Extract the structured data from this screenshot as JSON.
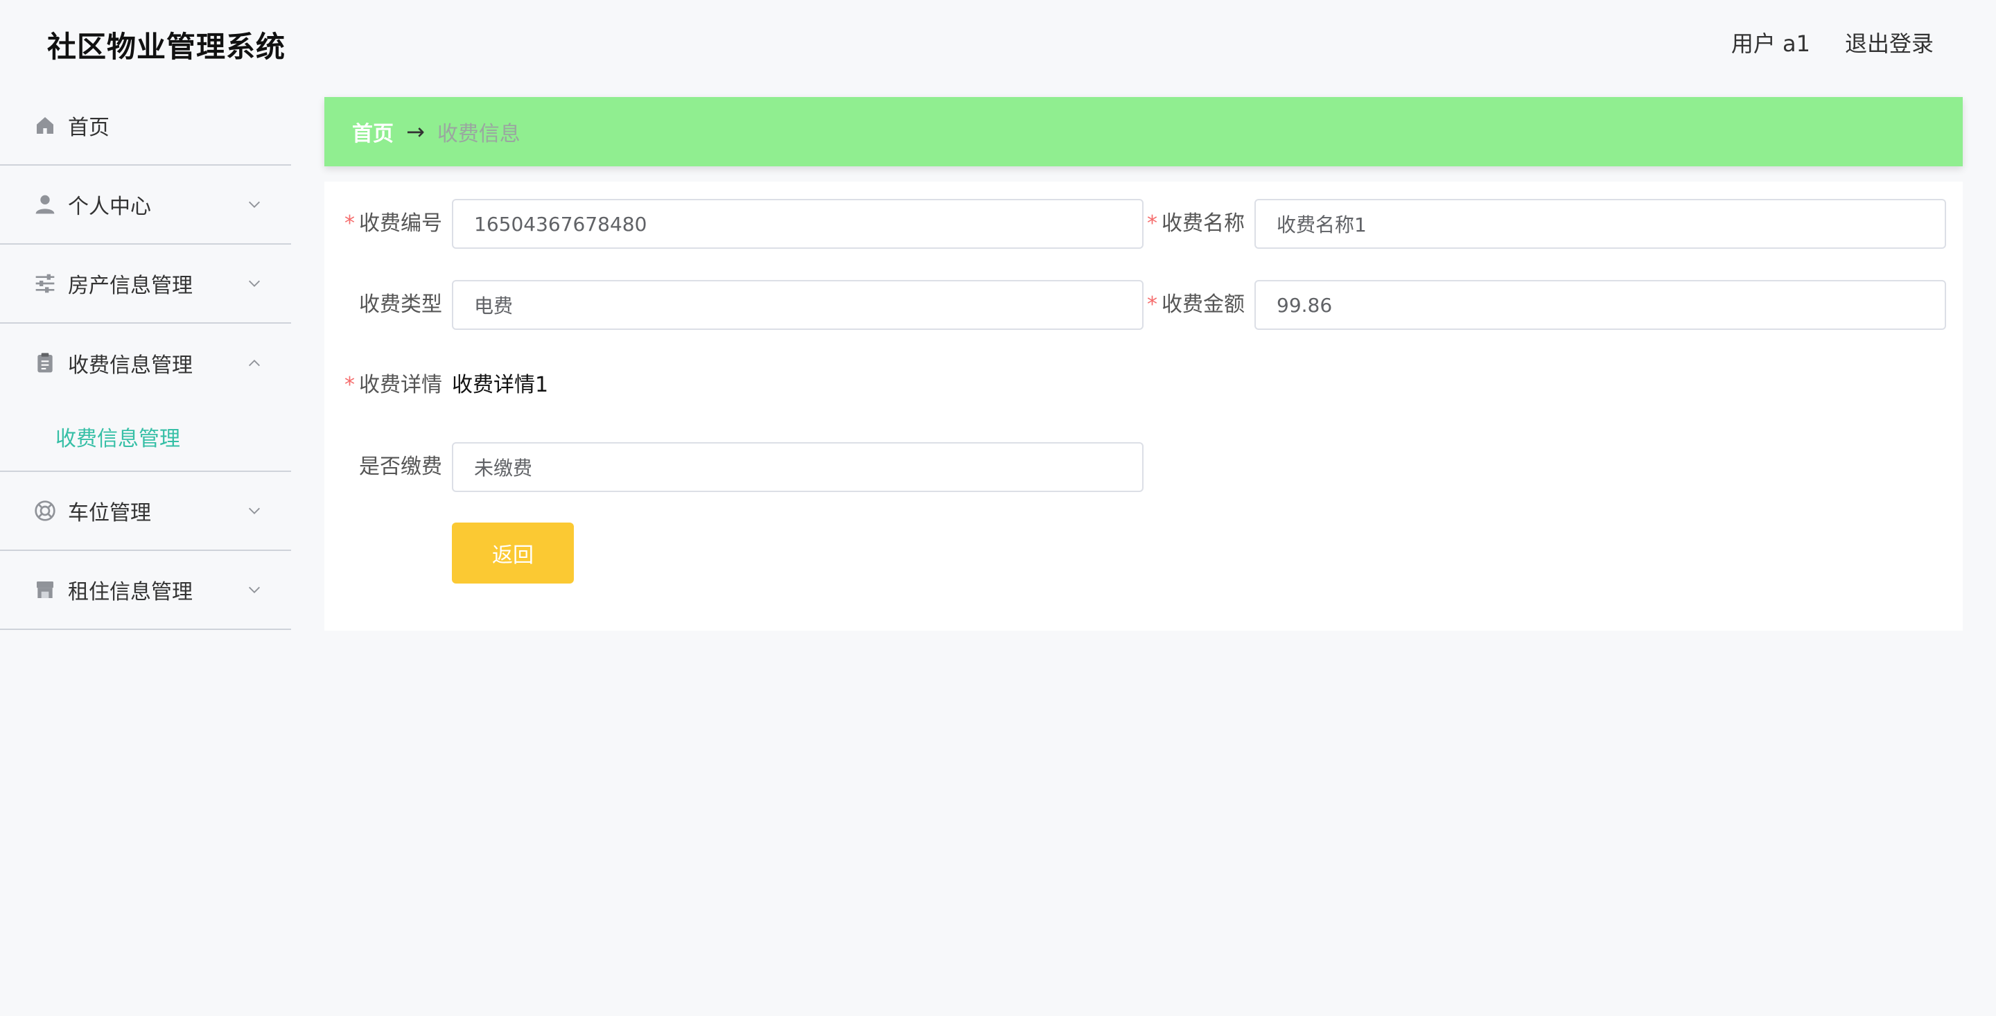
{
  "header": {
    "app_title": "社区物业管理系统",
    "user_label": "用户 a1",
    "logout_label": "退出登录"
  },
  "sidebar": {
    "items": [
      {
        "label": "首页",
        "icon": "home-icon"
      },
      {
        "label": "个人中心",
        "icon": "user-icon"
      },
      {
        "label": "房产信息管理",
        "icon": "sliders-icon"
      },
      {
        "label": "收费信息管理",
        "icon": "clipboard-icon",
        "expanded": true,
        "children": [
          {
            "label": "收费信息管理"
          }
        ]
      },
      {
        "label": "车位管理",
        "icon": "lifebuoy-icon"
      },
      {
        "label": "租住信息管理",
        "icon": "storefront-icon"
      }
    ]
  },
  "breadcrumb": {
    "home": "首页",
    "separator": "→",
    "current": "收费信息"
  },
  "form": {
    "fee_no": {
      "label": "收费编号",
      "value": "16504367678480",
      "required": true
    },
    "fee_name": {
      "label": "收费名称",
      "value": "收费名称1",
      "required": true
    },
    "fee_type": {
      "label": "收费类型",
      "value": "电费",
      "required": false
    },
    "fee_amount": {
      "label": "收费金额",
      "value": "99.86",
      "required": true
    },
    "fee_detail": {
      "label": "收费详情",
      "value": "收费详情1",
      "required": true
    },
    "paid": {
      "label": "是否缴费",
      "value": "未缴费",
      "required": false
    },
    "back_label": "返回"
  },
  "colors": {
    "breadcrumb_bg": "#90ee90",
    "active_menu": "#36bfa6",
    "back_button": "#fbc933",
    "required_mark": "#f56c6c"
  }
}
